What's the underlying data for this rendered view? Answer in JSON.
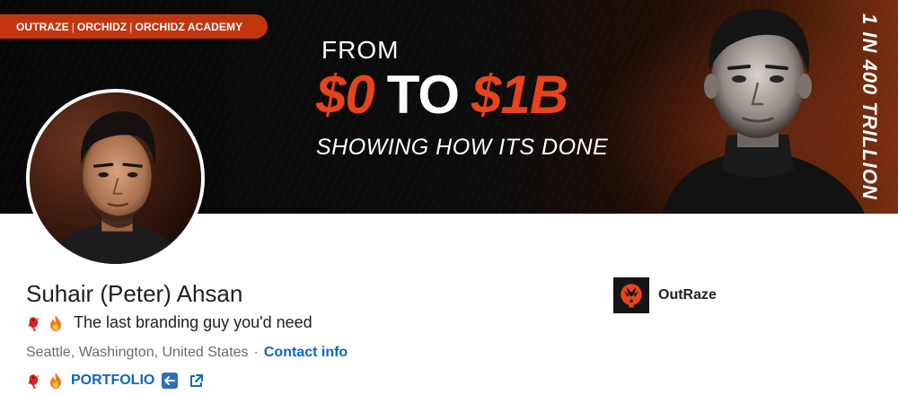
{
  "banner": {
    "brands": [
      "OUTRAZE",
      "ORCHIDZ",
      "ORCHIDZ ACADEMY"
    ],
    "brand_separator": "|",
    "headline_from": "FROM",
    "amount_start": "$0",
    "amount_to": "TO",
    "amount_end": "$1B",
    "subline": "SHOWING HOW ITS DONE",
    "vertical_slogan": "1 IN 400 TRILLION",
    "accent_color": "#e8431a"
  },
  "profile": {
    "name": "Suhair (Peter) Ahsan",
    "headline": "The last branding guy you'd need",
    "headline_emojis": [
      "bird-icon",
      "fire-icon"
    ],
    "location": "Seattle, Washington, United States",
    "separator": "·",
    "contact_label": "Contact info",
    "portfolio_label": "PORTFOLIO",
    "link_color": "#0a66c2"
  },
  "company": {
    "name": "OutRaze",
    "logo": "outraze-logo"
  }
}
